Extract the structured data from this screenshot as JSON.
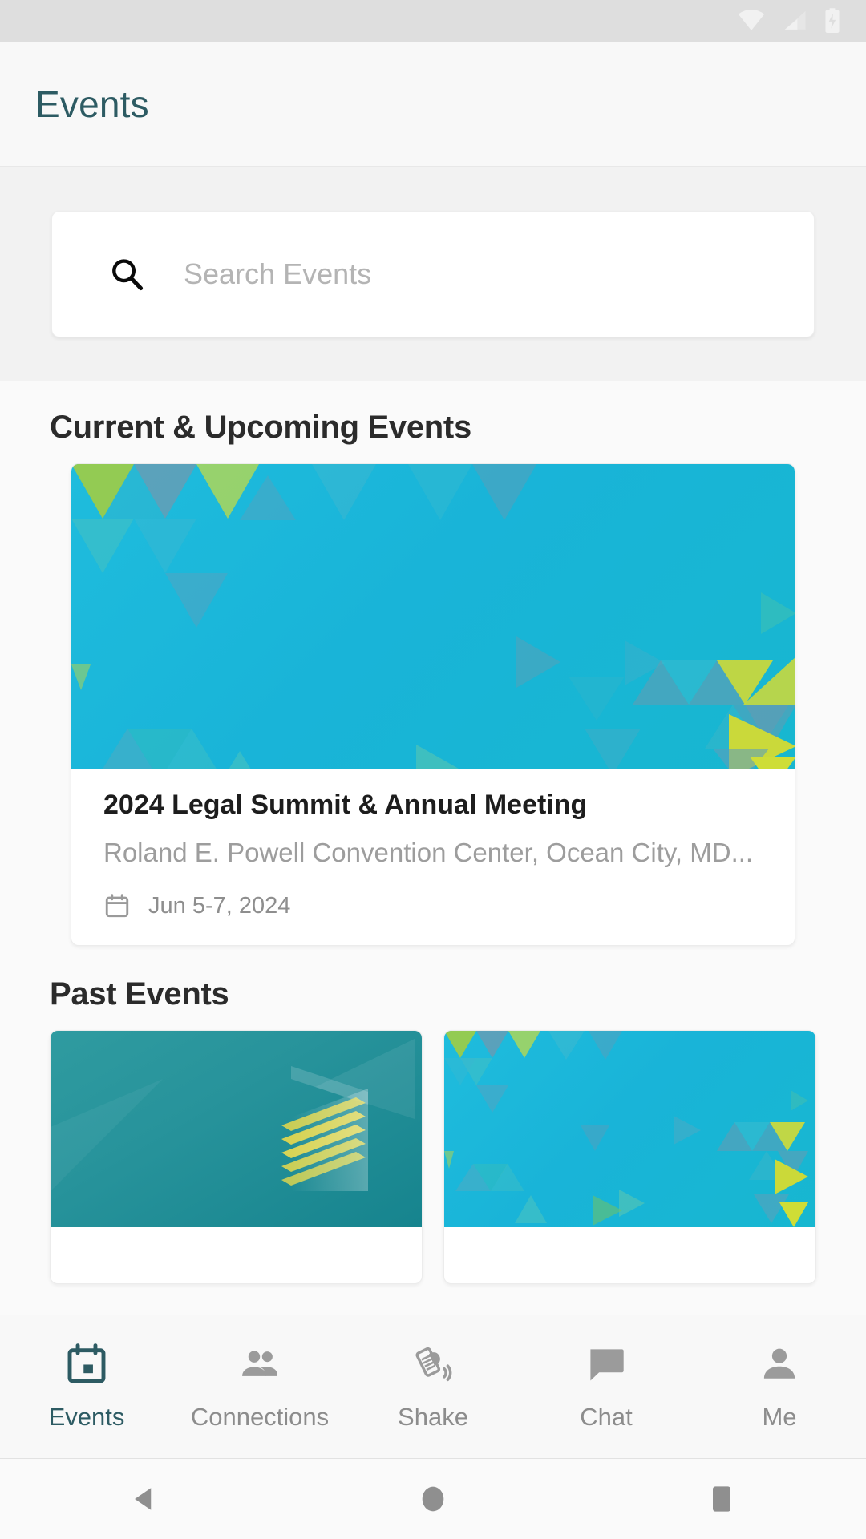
{
  "status_bar": {
    "icons": [
      "wifi-icon",
      "cellular-signal-icon",
      "battery-charging-icon"
    ],
    "icon_color": "#f1f1f1",
    "background": "#dedede"
  },
  "header": {
    "title": "Events",
    "title_color": "#2d5b63"
  },
  "search": {
    "placeholder": "Search Events",
    "value": "",
    "icon": "search-icon"
  },
  "sections": {
    "upcoming_title": "Current & Upcoming Events",
    "past_title": "Past Events"
  },
  "featured_event": {
    "title": "2024 Legal Summit & Annual Meeting",
    "location": "Roland E. Powell Convention Center, Ocean City, MD...",
    "date": "Jun 5-7, 2024",
    "date_icon": "calendar-icon",
    "banner_style": "cyan-triangles"
  },
  "past_events": [
    {
      "banner_style": "teal-chevron-logo"
    },
    {
      "banner_style": "cyan-triangles"
    }
  ],
  "bottom_nav": {
    "active_color": "#2d5b63",
    "inactive_color": "#8c8c8c",
    "items": [
      {
        "label": "Events",
        "icon": "calendar-icon",
        "active": true
      },
      {
        "label": "Connections",
        "icon": "people-icon",
        "active": false
      },
      {
        "label": "Shake",
        "icon": "shake-phone-icon",
        "active": false
      },
      {
        "label": "Chat",
        "icon": "chat-bubble-icon",
        "active": false
      },
      {
        "label": "Me",
        "icon": "person-icon",
        "active": false
      }
    ]
  },
  "android_nav": {
    "items": [
      {
        "name": "back-button",
        "icon": "triangle-left-icon"
      },
      {
        "name": "home-button",
        "icon": "circle-icon"
      },
      {
        "name": "recents-button",
        "icon": "square-icon"
      }
    ],
    "color": "#8f8f8f"
  }
}
